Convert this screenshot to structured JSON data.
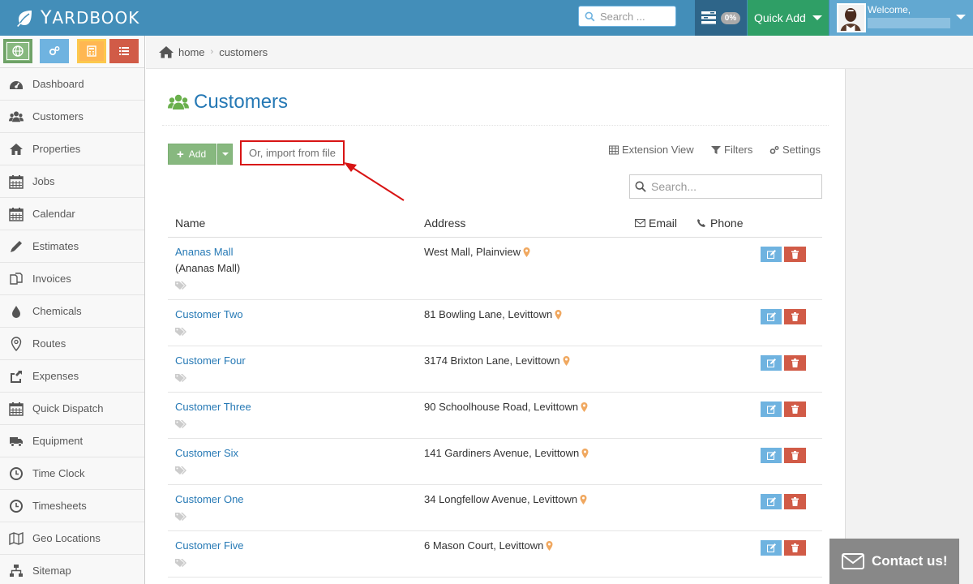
{
  "brand": {
    "first": "Y",
    "rest": "ARDBOOK"
  },
  "top_search": {
    "placeholder": "Search ..."
  },
  "tasks": {
    "percent": "0%"
  },
  "quick_add": {
    "label": "Quick Add"
  },
  "user": {
    "welcome": "Welcome,"
  },
  "breadcrumb": {
    "home": "home",
    "current": "customers"
  },
  "sidebar": {
    "items": [
      {
        "label": "Dashboard",
        "icon": "dashboard-icon"
      },
      {
        "label": "Customers",
        "icon": "users-icon"
      },
      {
        "label": "Properties",
        "icon": "home-icon"
      },
      {
        "label": "Jobs",
        "icon": "calendar-icon"
      },
      {
        "label": "Calendar",
        "icon": "calendar-icon"
      },
      {
        "label": "Estimates",
        "icon": "pencil-icon"
      },
      {
        "label": "Invoices",
        "icon": "files-icon"
      },
      {
        "label": "Chemicals",
        "icon": "droplet-icon"
      },
      {
        "label": "Routes",
        "icon": "map-marker-icon"
      },
      {
        "label": "Expenses",
        "icon": "share-icon"
      },
      {
        "label": "Quick Dispatch",
        "icon": "calendar-icon"
      },
      {
        "label": "Equipment",
        "icon": "truck-icon"
      },
      {
        "label": "Time Clock",
        "icon": "clock-icon"
      },
      {
        "label": "Timesheets",
        "icon": "clock-icon"
      },
      {
        "label": "Geo Locations",
        "icon": "map-icon"
      },
      {
        "label": "Sitemap",
        "icon": "sitemap-icon"
      }
    ]
  },
  "page": {
    "title": "Customers",
    "add_label": "Add",
    "import_label": "Or, import from file",
    "tools": {
      "extension_view": "Extension View",
      "filters": "Filters",
      "settings": "Settings"
    },
    "table_search_placeholder": "Search..."
  },
  "table": {
    "headers": {
      "name": "Name",
      "address": "Address",
      "email": "Email",
      "phone": "Phone"
    },
    "rows": [
      {
        "name": "Ananas Mall",
        "sub": "(Ananas Mall)",
        "address": "West Mall, Plainview"
      },
      {
        "name": "Customer Two",
        "sub": "",
        "address": "81 Bowling Lane, Levittown"
      },
      {
        "name": "Customer Four",
        "sub": "",
        "address": "3174 Brixton Lane, Levittown"
      },
      {
        "name": "Customer Three",
        "sub": "",
        "address": "90 Schoolhouse Road, Levittown"
      },
      {
        "name": "Customer Six",
        "sub": "",
        "address": "141 Gardiners Avenue, Levittown"
      },
      {
        "name": "Customer One",
        "sub": "",
        "address": "34 Longfellow Avenue, Levittown"
      },
      {
        "name": "Customer Five",
        "sub": "",
        "address": "6 Mason Court, Levittown"
      }
    ]
  },
  "contact": {
    "label": "Contact us!"
  },
  "colors": {
    "topbar": "#438eb9",
    "link": "#2679b5",
    "quick_add": "#2f9f66",
    "edit": "#6fb3e0",
    "delete": "#d15b47",
    "highlight": "#d81414"
  }
}
